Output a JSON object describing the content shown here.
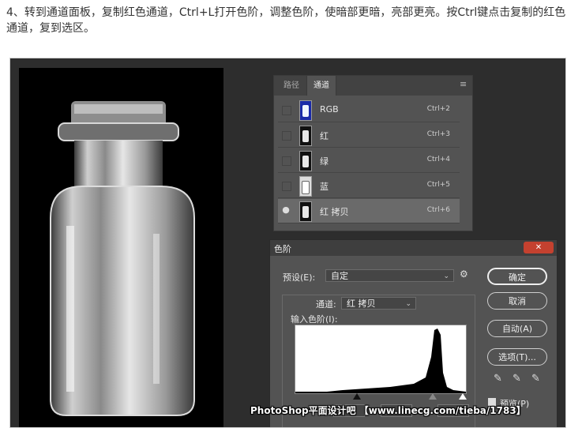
{
  "instruction": "4、转到通道面板，复制红色通道，Ctrl+L打开色阶，调整色阶，使暗部更暗，亮部更亮。按Ctrl键点击复制的红色通道，复到选区。",
  "channels_panel": {
    "tabs": [
      {
        "label": "路径"
      },
      {
        "label": "通道"
      }
    ],
    "menu_icon": "≡",
    "channels": [
      {
        "name": "RGB",
        "shortcut": "Ctrl+2"
      },
      {
        "name": "红",
        "shortcut": "Ctrl+3"
      },
      {
        "name": "绿",
        "shortcut": "Ctrl+4"
      },
      {
        "name": "蓝",
        "shortcut": "Ctrl+5"
      },
      {
        "name": "红 拷贝",
        "shortcut": "Ctrl+6"
      }
    ]
  },
  "levels_dialog": {
    "title": "色阶",
    "preset_label": "预设(E):",
    "preset_value": "自定",
    "channel_label": "通道:",
    "channel_value": "红 拷贝",
    "input_levels_label": "输入色阶(I):",
    "buttons": {
      "ok": "确定",
      "cancel": "取消",
      "auto": "自动(A)",
      "options": "选项(T)..."
    },
    "preview_label": "预览(P)"
  },
  "watermark": "PhotoShop平面设计吧 【www.linecg.com/tieba/1783】"
}
